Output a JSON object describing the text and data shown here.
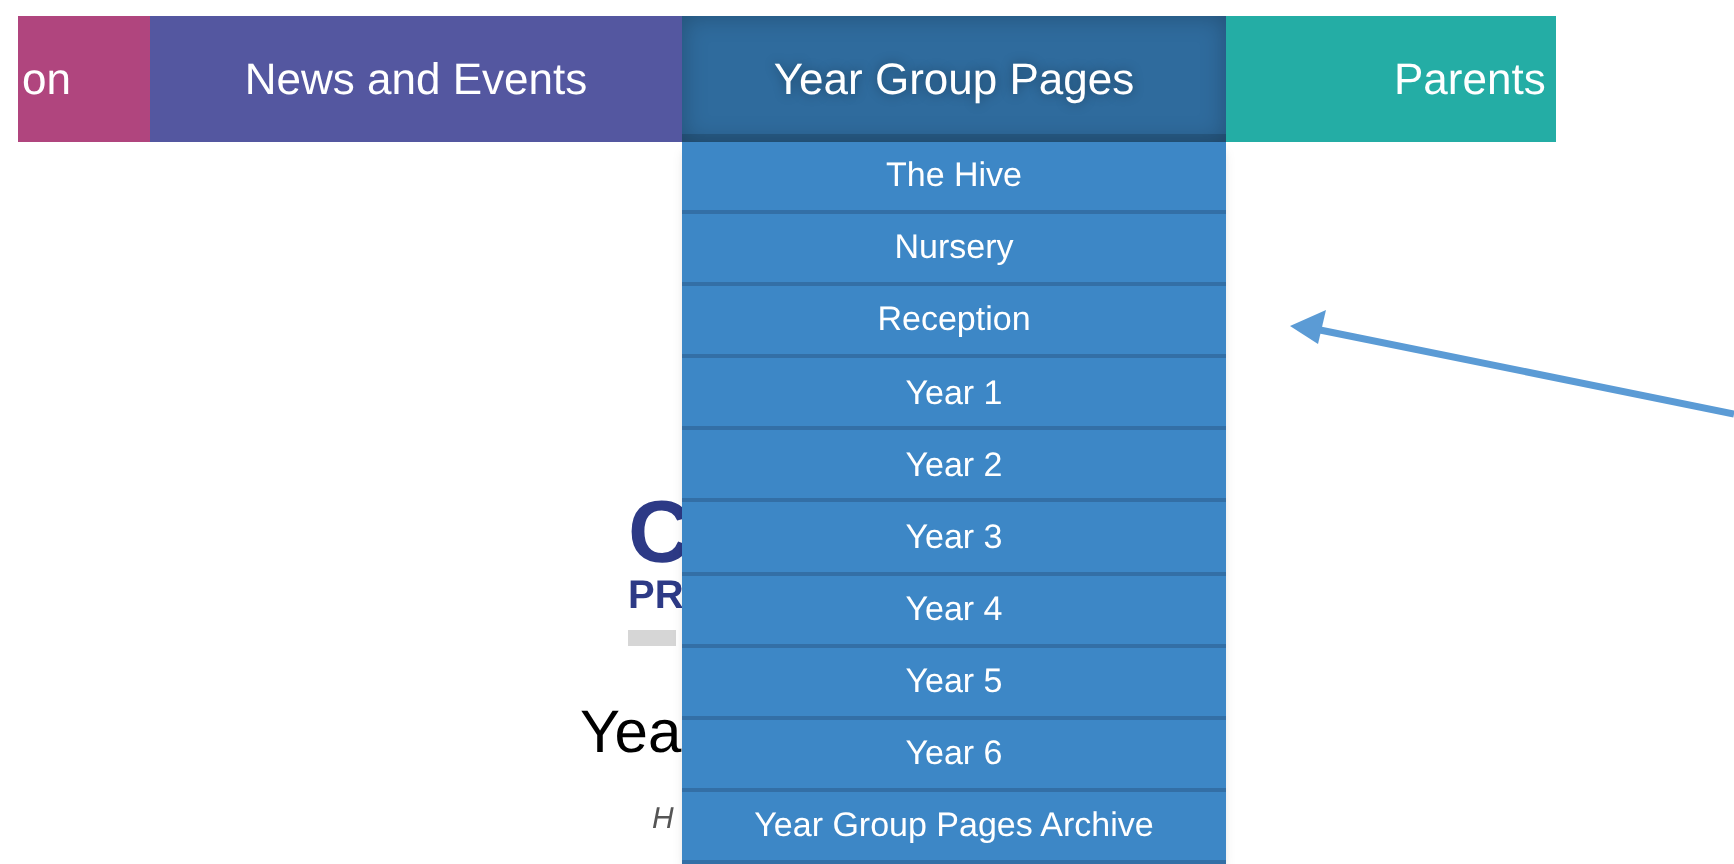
{
  "nav": [
    {
      "label": "on",
      "color": "#b0457e",
      "selected": false
    },
    {
      "label": "News and Events",
      "color": "#5457a0",
      "selected": false
    },
    {
      "label": "Year Group Pages",
      "color": "#2f6b9d",
      "selected": true
    },
    {
      "label": "Parents",
      "color": "#24ada5",
      "selected": false
    }
  ],
  "dropdown": [
    "The Hive",
    "Nursery",
    "Reception",
    "Year 1",
    "Year 2",
    "Year 3",
    "Year 4",
    "Year 5",
    "Year 6",
    "Year Group Pages Archive"
  ],
  "page": {
    "logo_top": "C",
    "logo_bottom": "PR",
    "heading": "Yea",
    "subtitle": "H"
  }
}
